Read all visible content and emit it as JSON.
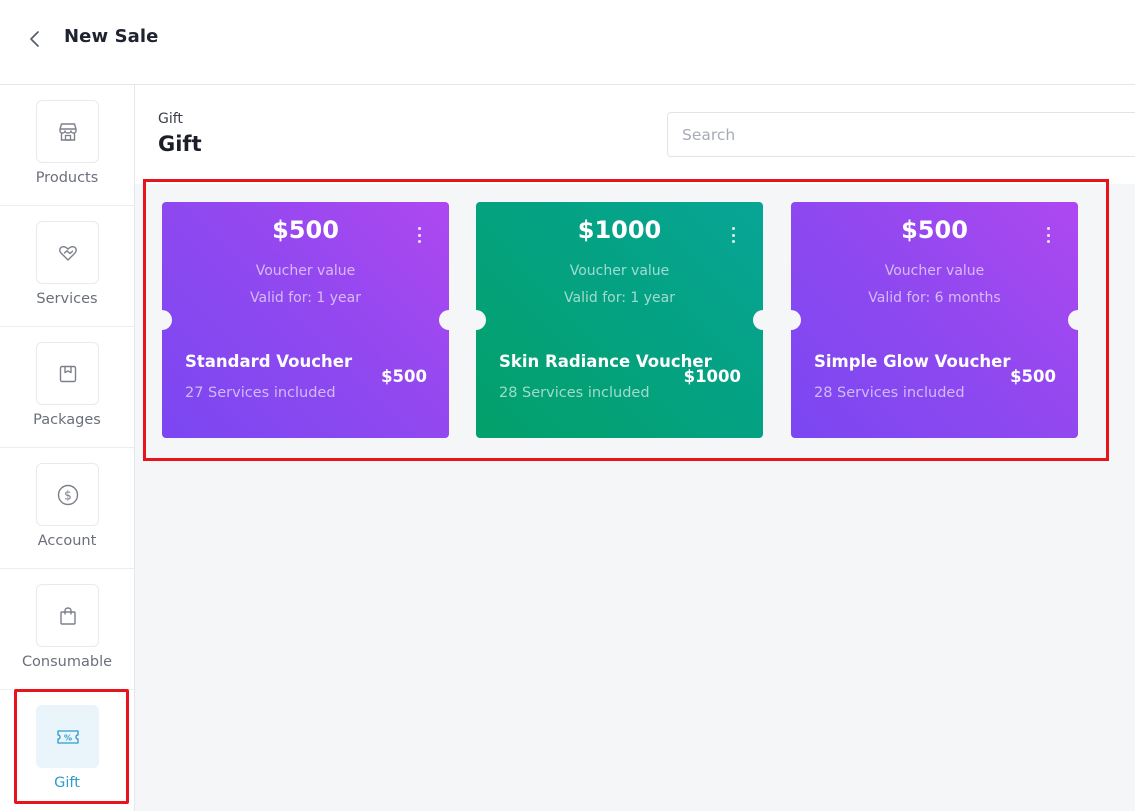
{
  "header": {
    "title": "New Sale"
  },
  "sidebar": {
    "items": [
      {
        "label": "Products",
        "icon": "store-icon"
      },
      {
        "label": "Services",
        "icon": "heart-handshake-icon"
      },
      {
        "label": "Packages",
        "icon": "box-icon"
      },
      {
        "label": "Account",
        "icon": "dollar-circle-icon"
      },
      {
        "label": "Consumable",
        "icon": "shopping-bag-icon"
      },
      {
        "label": "Gift",
        "icon": "voucher-ticket-icon",
        "active": true
      }
    ]
  },
  "main": {
    "breadcrumb": "Gift",
    "title": "Gift",
    "search": {
      "placeholder": "Search",
      "value": ""
    }
  },
  "vouchers": [
    {
      "amount": "$500",
      "value_label": "Voucher value",
      "validity": "Valid for: 1 year",
      "name": "Standard Voucher",
      "services": "27 Services included",
      "price": "$500",
      "color": "#8f47f0"
    },
    {
      "amount": "$1000",
      "value_label": "Voucher value",
      "validity": "Valid for: 1 year",
      "name": "Skin Radiance Voucher",
      "services": "28 Services included",
      "price": "$1000",
      "color": "#04a27c"
    },
    {
      "amount": "$500",
      "value_label": "Voucher value",
      "validity": "Valid for: 6 months",
      "name": "Simple Glow Voucher",
      "services": "28 Services included",
      "price": "$500",
      "color": "#8f47f0"
    }
  ],
  "colors": {
    "accent": "#2e9ccc",
    "highlight": "#e8141b",
    "voucher_purple": "#8f47f0",
    "voucher_green": "#04a27c"
  }
}
